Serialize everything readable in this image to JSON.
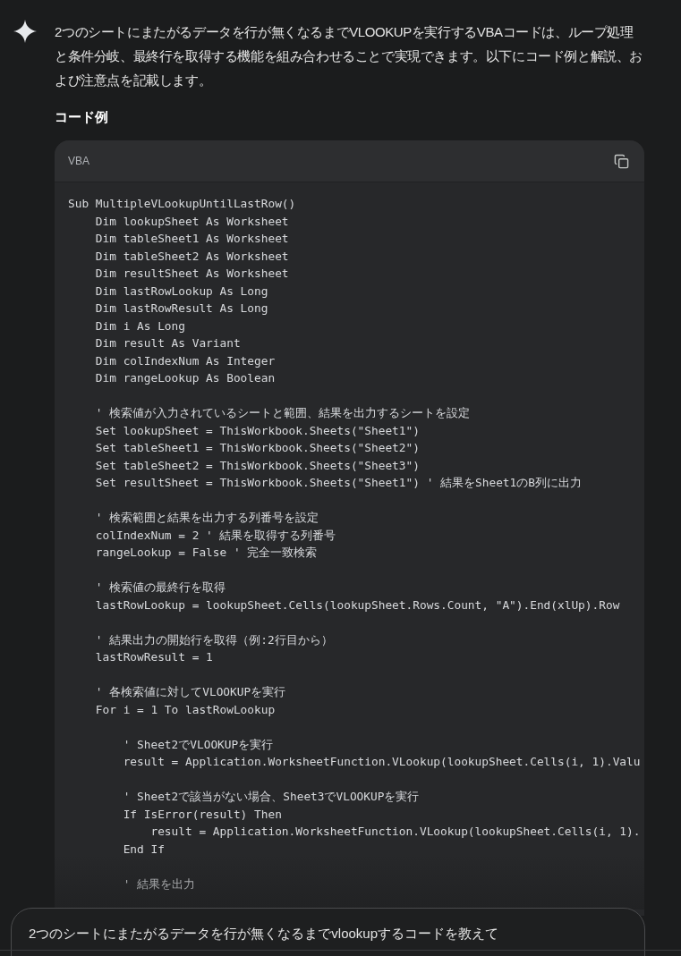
{
  "message": {
    "text": "2つのシートにまたがるデータを行が無くなるまでVLOOKUPを実行するVBAコードは、ループ処理と条件分岐、最終行を取得する機能を組み合わせることで実現できます。以下にコード例と解説、および注意点を記載します。"
  },
  "section_heading": "コード例",
  "code_block": {
    "language": "VBA",
    "blocks": [
      [
        "Sub MultipleVLookupUntilLastRow()",
        "    Dim lookupSheet As Worksheet",
        "    Dim tableSheet1 As Worksheet",
        "    Dim tableSheet2 As Worksheet",
        "    Dim resultSheet As Worksheet",
        "    Dim lastRowLookup As Long",
        "    Dim lastRowResult As Long",
        "    Dim i As Long",
        "    Dim result As Variant",
        "    Dim colIndexNum As Integer",
        "    Dim rangeLookup As Boolean"
      ],
      [
        "    ' 検索値が入力されているシートと範囲、結果を出力するシートを設定",
        "    Set lookupSheet = ThisWorkbook.Sheets(\"Sheet1\")",
        "    Set tableSheet1 = ThisWorkbook.Sheets(\"Sheet2\")",
        "    Set tableSheet2 = ThisWorkbook.Sheets(\"Sheet3\")",
        "    Set resultSheet = ThisWorkbook.Sheets(\"Sheet1\") ' 結果をSheet1のB列に出力"
      ],
      [
        "    ' 検索範囲と結果を出力する列番号を設定",
        "    colIndexNum = 2 ' 結果を取得する列番号",
        "    rangeLookup = False ' 完全一致検索"
      ],
      [
        "    ' 検索値の最終行を取得",
        "    lastRowLookup = lookupSheet.Cells(lookupSheet.Rows.Count, \"A\").End(xlUp).Row"
      ],
      [
        "    ' 結果出力の開始行を取得（例:2行目から）",
        "    lastRowResult = 1"
      ],
      [
        "    ' 各検索値に対してVLOOKUPを実行",
        "    For i = 1 To lastRowLookup"
      ],
      [
        "        ' Sheet2でVLOOKUPを実行",
        "        result = Application.WorksheetFunction.VLookup(lookupSheet.Cells(i, 1).Valu"
      ],
      [
        "        ' Sheet2で該当がない場合、Sheet3でVLOOKUPを実行",
        "        If IsError(result) Then",
        "            result = Application.WorksheetFunction.VLookup(lookupSheet.Cells(i, 1).",
        "        End If"
      ],
      [
        "        ' 結果を出力"
      ]
    ]
  },
  "prompt_input": {
    "value": "2つのシートにまたがるデータを行が無くなるまでvlookupするコードを教えて"
  }
}
